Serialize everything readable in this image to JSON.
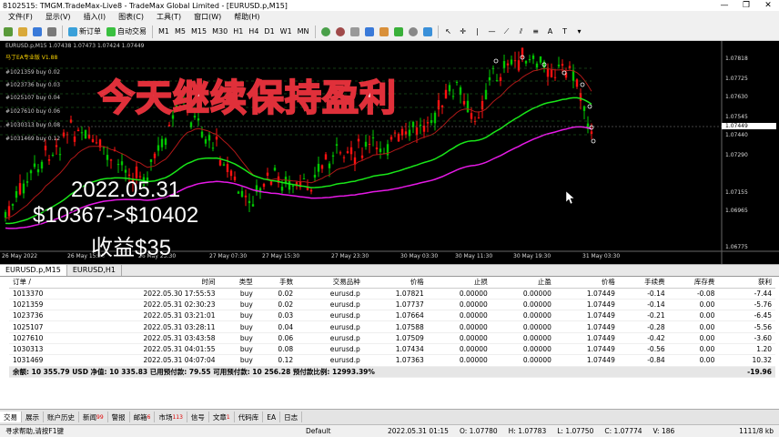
{
  "window": {
    "title": "8102515: TMGM.TradeMax-Live8 - TradeMax Global Limited - [EURUSD.p,M15]",
    "controls": [
      "—",
      "❐",
      "✕"
    ]
  },
  "menu": [
    "文件(F)",
    "显示(V)",
    "插入(I)",
    "图表(C)",
    "工具(T)",
    "窗口(W)",
    "帮助(H)"
  ],
  "toolbar": {
    "new_order": "新订单",
    "autotrade": "自动交易",
    "timeframes": [
      "M1",
      "M5",
      "M15",
      "M30",
      "H1",
      "H4",
      "D1",
      "W1",
      "MN"
    ]
  },
  "chart": {
    "symbol_line": "EURUSD.p,M15  1.07438 1.07473 1.07424 1.07449",
    "indicator": "马丁EA专业版  V1.88",
    "orders": [
      "#1021359 buy 0.02",
      "#1023736 buy 0.03",
      "#1025107 buy 0.04",
      "#1027610 buy 0.06",
      "#1030313 buy 0.08",
      "#1031469 buy 0.12"
    ],
    "price_labels": [
      "1.07818",
      "1.07725",
      "1.07630",
      "1.07545",
      "1.07449",
      "1.07440",
      "1.07290",
      "1.07155",
      "1.06965",
      "1.06775"
    ],
    "time_labels": [
      "26 May 2022",
      "26 May 15:30",
      "26 May 23:30",
      "27 May 07:30",
      "27 May 15:30",
      "27 May 23:30",
      "30 May 03:30",
      "30 May 11:30",
      "30 May 19:30",
      "31 May 03:30"
    ],
    "overlay_title": "今天继续保持盈利",
    "overlay_date": "2022.05.31",
    "overlay_balance": "$10367->$10402",
    "overlay_profit": "收益$35",
    "colors": {
      "bull": "#00c800",
      "bear": "#ff1010",
      "ma_green": "#19e619",
      "ma_magenta": "#e619e6",
      "ma_darkred": "#b01818"
    }
  },
  "chart_tabs": [
    "EURUSD.p,M15",
    "EURUSD,H1"
  ],
  "terminal": {
    "columns": [
      "订单 /",
      "时间",
      "类型",
      "手数",
      "交易品种",
      "价格",
      "止损",
      "止盈",
      "价格",
      "手续费",
      "库存费",
      "获利"
    ],
    "rows": [
      [
        "1013370",
        "2022.05.30 17:55:53",
        "buy",
        "0.02",
        "eurusd.p",
        "1.07821",
        "0.00000",
        "0.00000",
        "1.07449",
        "-0.14",
        "-0.08",
        "-7.44"
      ],
      [
        "1021359",
        "2022.05.31 02:30:23",
        "buy",
        "0.02",
        "eurusd.p",
        "1.07737",
        "0.00000",
        "0.00000",
        "1.07449",
        "-0.14",
        "0.00",
        "-5.76"
      ],
      [
        "1023736",
        "2022.05.31 03:21:01",
        "buy",
        "0.03",
        "eurusd.p",
        "1.07664",
        "0.00000",
        "0.00000",
        "1.07449",
        "-0.21",
        "0.00",
        "-6.45"
      ],
      [
        "1025107",
        "2022.05.31 03:28:11",
        "buy",
        "0.04",
        "eurusd.p",
        "1.07588",
        "0.00000",
        "0.00000",
        "1.07449",
        "-0.28",
        "0.00",
        "-5.56"
      ],
      [
        "1027610",
        "2022.05.31 03:43:58",
        "buy",
        "0.06",
        "eurusd.p",
        "1.07509",
        "0.00000",
        "0.00000",
        "1.07449",
        "-0.42",
        "0.00",
        "-3.60"
      ],
      [
        "1030313",
        "2022.05.31 04:01:55",
        "buy",
        "0.08",
        "eurusd.p",
        "1.07434",
        "0.00000",
        "0.00000",
        "1.07449",
        "-0.56",
        "0.00",
        "1.20"
      ],
      [
        "1031469",
        "2022.05.31 04:07:04",
        "buy",
        "0.12",
        "eurusd.p",
        "1.07363",
        "0.00000",
        "0.00000",
        "1.07449",
        "-0.84",
        "0.00",
        "10.32"
      ]
    ],
    "balance_line": "余额: 10 355.79 USD  净值: 10 335.83  已用预付款: 79.55  可用预付款: 10 256.28  预付款比例: 12993.39%",
    "total_profit": "-19.96"
  },
  "bottom_tabs": [
    {
      "label": "交易",
      "badge": ""
    },
    {
      "label": "展示",
      "badge": ""
    },
    {
      "label": "账户历史",
      "badge": ""
    },
    {
      "label": "新闻",
      "badge": "99"
    },
    {
      "label": "警报",
      "badge": ""
    },
    {
      "label": "邮箱",
      "badge": "6"
    },
    {
      "label": "市场",
      "badge": "113"
    },
    {
      "label": "信号",
      "badge": ""
    },
    {
      "label": "文章",
      "badge": "1"
    },
    {
      "label": "代码库",
      "badge": ""
    },
    {
      "label": "EA",
      "badge": ""
    },
    {
      "label": "日志",
      "badge": ""
    }
  ],
  "statusbar": {
    "help": "寻求帮助,请按F1键",
    "profile": "Default",
    "datetime": "2022.05.31 01:15",
    "open": "O: 1.07780",
    "high": "H: 1.07783",
    "low": "L: 1.07750",
    "close": "C: 1.07774",
    "volume": "V: 186",
    "traffic": "1111/8 kb"
  }
}
